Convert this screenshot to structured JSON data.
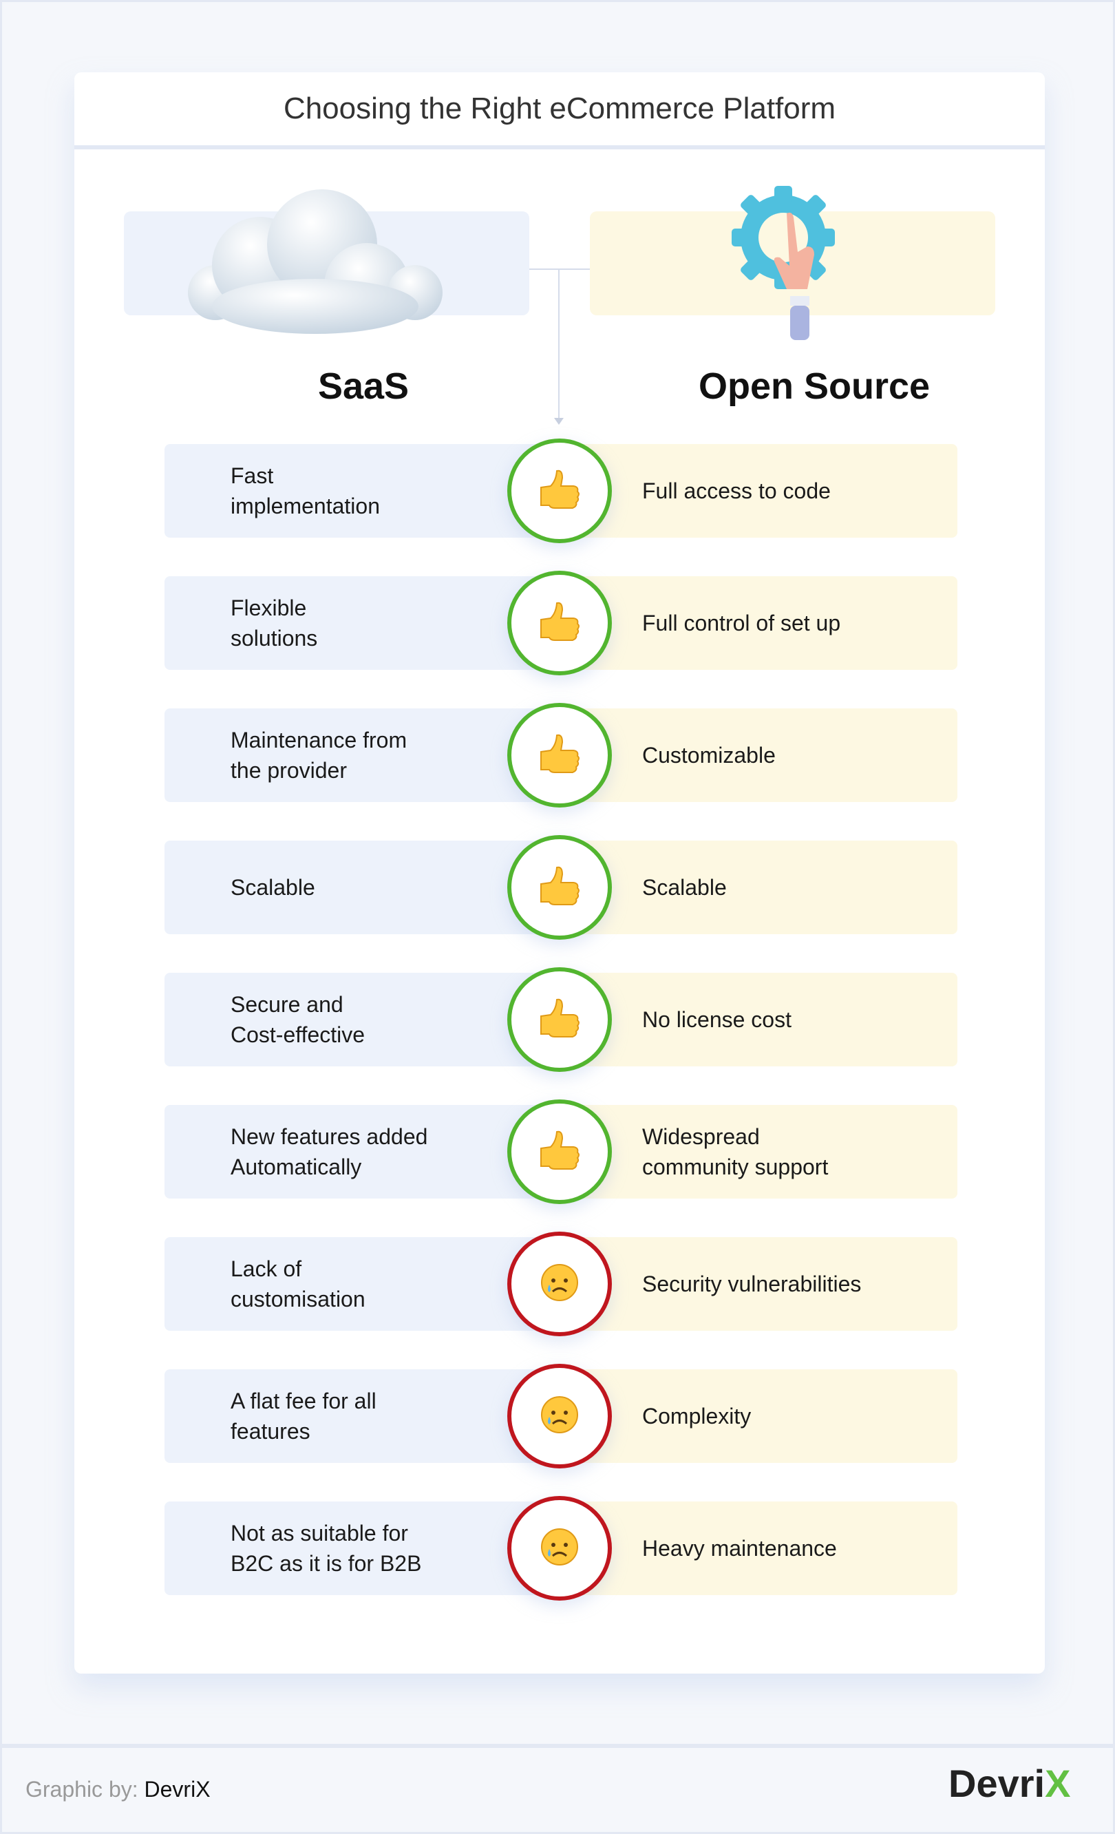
{
  "title": "Choosing the Right eCommerce Platform",
  "columns": {
    "left": "SaaS",
    "right": "Open Source"
  },
  "colors": {
    "pro": "#52b52f",
    "con": "#c0161e",
    "left_bg": "#edf2fb",
    "right_bg": "#fdf8e2"
  },
  "rows": [
    {
      "left": "Fast\nimplementation",
      "right": "Full access to code",
      "icon": "thumbs-up-icon",
      "type": "pro"
    },
    {
      "left": "Flexible\nsolutions",
      "right": "Full control of set up",
      "icon": "thumbs-up-icon",
      "type": "pro"
    },
    {
      "left": "Maintenance from\nthe provider",
      "right": "Customizable",
      "icon": "thumbs-up-icon",
      "type": "pro"
    },
    {
      "left": "Scalable",
      "right": "Scalable",
      "icon": "thumbs-up-icon",
      "type": "pro"
    },
    {
      "left": "Secure and\nCost-effective",
      "right": "No license cost",
      "icon": "thumbs-up-icon",
      "type": "pro"
    },
    {
      "left": "New features added\nAutomatically",
      "right": "Widespread\ncommunity support",
      "icon": "thumbs-up-icon",
      "type": "pro"
    },
    {
      "left": "Lack of\ncustomisation",
      "right": "Security vulnerabilities",
      "icon": "sad-face-icon",
      "type": "con"
    },
    {
      "left": "A flat fee for all\nfeatures",
      "right": "Complexity",
      "icon": "sad-face-icon",
      "type": "con"
    },
    {
      "left": "Not as suitable for\nB2C as it is for B2B",
      "right": "Heavy maintenance",
      "icon": "sad-face-icon",
      "type": "con"
    }
  ],
  "footer": {
    "credit_label": "Graphic by:",
    "credit_name": "DevriX",
    "logo_text": "Devri",
    "logo_mark": "X"
  }
}
